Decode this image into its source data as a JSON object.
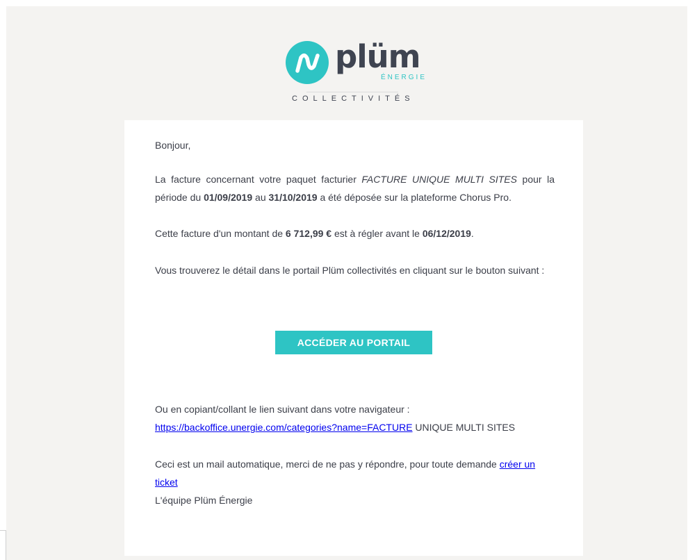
{
  "brand": {
    "name": "plüm",
    "sub": "ÉNERGIE",
    "tagline": "COLLECTIVITÉS",
    "accent_color": "#2ec4c4",
    "dark_color": "#3f4451",
    "icon": "plum-wave-logo-icon"
  },
  "email": {
    "greeting": "Bonjour,",
    "p1_a": "La facture concernant votre paquet facturier ",
    "p1_packet": "FACTURE UNIQUE MULTI SITES",
    "p1_b": " pour la période du ",
    "p1_start": "01/09/2019",
    "p1_c": " au ",
    "p1_end": "31/10/2019",
    "p1_d": " a été déposée sur la plateforme Chorus Pro.",
    "p2_a": "Cette facture d'un montant de ",
    "p2_amount": "6 712,99 €",
    "p2_b": " est à régler avant le ",
    "p2_due": "06/12/2019",
    "p2_c": ".",
    "p3": "Vous trouverez le détail dans le portail Plüm collectivités en cliquant sur le bouton suivant :",
    "button_label": "ACCÉDER AU PORTAIL",
    "p4_line1": "Ou en copiant/collant le lien suivant dans votre navigateur :",
    "p4_link": "https://backoffice.unergie.com/categories?name=FACTURE",
    "p4_rest": " UNIQUE MULTI SITES",
    "p5_a": "Ceci est un mail automatique, merci de ne pas y répondre, pour toute demande ",
    "p5_link": "créer un ticket",
    "signature": "L'équipe Plüm Énergie"
  }
}
